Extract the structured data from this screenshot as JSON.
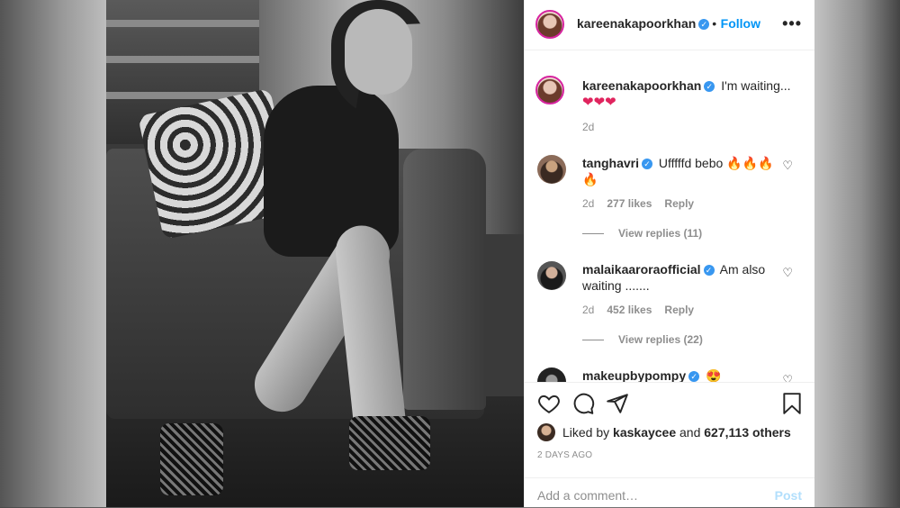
{
  "post": {
    "author": "kareenakapoorkhan",
    "follow_label": "Follow",
    "more_label": "•••",
    "dot": "•"
  },
  "caption": {
    "username": "kareenakapoorkhan",
    "text": "I'm waiting...",
    "hearts": "❤❤❤",
    "time": "2d"
  },
  "comments": [
    {
      "username": "tanghavri",
      "text": "Ufffffd bebo 🔥🔥🔥",
      "text_line2": "🔥",
      "time": "2d",
      "likes": "277 likes",
      "reply": "Reply",
      "view_replies": "View replies (11)"
    },
    {
      "username": "malaikaaroraofficial",
      "text": "Am also",
      "text_line2": "waiting .......",
      "time": "2d",
      "likes": "452 likes",
      "reply": "Reply",
      "view_replies": "View replies (22)"
    },
    {
      "username": "makeupbypompy",
      "text": "😍"
    }
  ],
  "engagement": {
    "liked_by_prefix": "Liked by",
    "liked_by_user": "kaskaycee",
    "and": "and",
    "others": "627,113 others",
    "time_ago": "2 DAYS AGO"
  },
  "composer": {
    "placeholder": "Add a comment…",
    "post_label": "Post"
  },
  "icons": {
    "verified": "verified-badge-icon",
    "like": "heart-icon",
    "comment": "comment-bubble-icon",
    "share": "paper-plane-icon",
    "save": "bookmark-icon"
  },
  "colors": {
    "accent": "#0095f6",
    "verified": "#3897f0",
    "muted": "#8e8e8e",
    "post_disabled": "#b2dffc"
  }
}
